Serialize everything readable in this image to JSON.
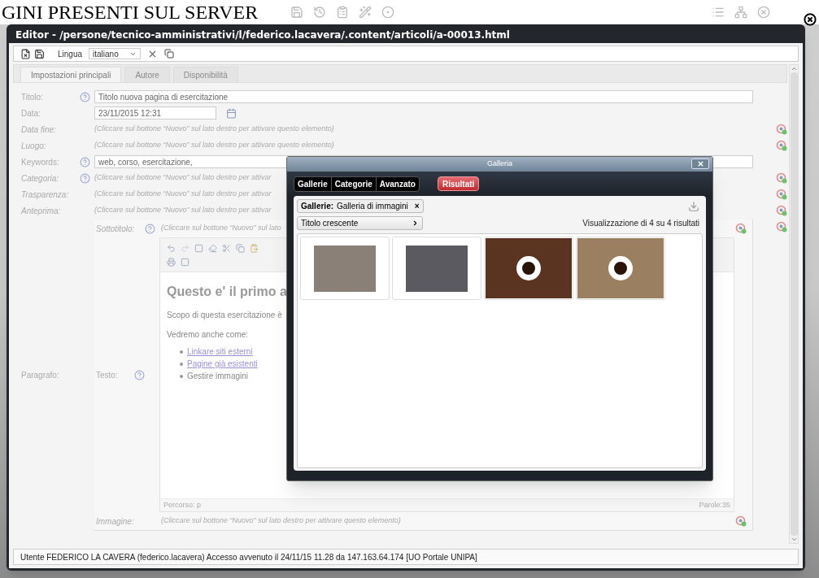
{
  "page": {
    "heading": "GINI PRESENTI SUL SERVER"
  },
  "editor": {
    "title": "Editor - /persone/tecnico-amministrativi/l/federico.lacavera/.content/articoli/a-00013.html",
    "toolbar": {
      "language_label": "Lingua",
      "language_value": "italiano"
    },
    "tabs": [
      {
        "label": "Impostazioni principali",
        "selected": true
      },
      {
        "label": "Autore",
        "selected": false
      },
      {
        "label": "Disponibilità",
        "selected": false
      }
    ],
    "fields": [
      {
        "label": "Titolo:",
        "kind": "input",
        "help": true,
        "value": "Titolo nuova pagina di esercitazione"
      },
      {
        "label": "Data:",
        "kind": "date",
        "help": false,
        "value": "23/11/2015 12:31"
      },
      {
        "label": "Data fine:",
        "kind": "inactive",
        "help": false,
        "text": "(Cliccare sul bottone “Nuovo” sul lato destro per attivare questo elemento)"
      },
      {
        "label": "Luogo:",
        "kind": "inactive",
        "help": false,
        "text": "(Cliccare sul bottone “Nuovo” sul lato destro per attivare questo elemento)"
      },
      {
        "label": "Keywords:",
        "kind": "input",
        "help": true,
        "value": "web, corso, esercitazione,"
      },
      {
        "label": "Categoria:",
        "kind": "inactive",
        "help": true,
        "text": "(Cliccare sul bottone “Nuovo” sul lato destro per attivar"
      },
      {
        "label": "Trasparenza:",
        "kind": "inactive",
        "help": false,
        "text": "(Cliccare sul bottone “Nuovo” sul lato destro per attivar"
      },
      {
        "label": "Anteprima:",
        "kind": "inactive",
        "help": false,
        "text": "(Cliccare sul bottone “Nuovo” sul lato destro per attivar"
      }
    ],
    "paragraph": {
      "label": "Paragrafo:",
      "subtitle": {
        "label": "Sottotitolo:",
        "help": true,
        "text": "(Cliccare sul bottone “Nuovo” sul lato"
      },
      "text_label": "Testo:",
      "text_help": true,
      "rte": {
        "heading": "Questo e' il primo a",
        "paragraphs": [
          "Scopo di questa esercitazione è",
          "Vedremo anche come:"
        ],
        "list": [
          {
            "text": "Linkare siti esterni",
            "kind": "link"
          },
          {
            "text": "Pagine già esistenti",
            "kind": "link"
          },
          {
            "text": "Gestire immagini",
            "kind": "plain"
          }
        ],
        "path": "Percorso: p",
        "words": "Parole:35"
      },
      "image": {
        "label": "Immagine:",
        "text": "(Cliccare sul bottone “Nuovo” sul lato destro per attivare questo elemento)"
      }
    },
    "status": "Utente FEDERICO LA CAVERA (federico.lacavera) Accesso avvenuto il 24/11/15 11.28 da 147.163.64.174 [UO Portale UNIPA]"
  },
  "gallery": {
    "title": "Galleria",
    "tabs": [
      {
        "label": "Gallerie",
        "selected": false
      },
      {
        "label": "Categorie",
        "selected": false
      },
      {
        "label": "Avanzato",
        "selected": false
      },
      {
        "label": "Risultati",
        "selected": true
      }
    ],
    "filter": {
      "name": "Gallerie:",
      "value": "Galleria di immagini",
      "remove": "×"
    },
    "sort": "Titolo crescente",
    "count": "Visualizzazione di 4 su 4 risultati",
    "thumbnails": [
      {
        "kind": "inset"
      },
      {
        "kind": "inset"
      },
      {
        "kind": "full"
      },
      {
        "kind": "full"
      }
    ]
  }
}
